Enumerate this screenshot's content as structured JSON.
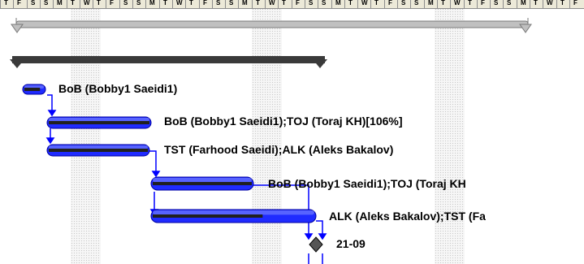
{
  "colors": {
    "task_bar": "#1f2bff",
    "task_bar_light": "#6f7cff",
    "progress": "#202020",
    "summary_bar": "#3a3a3a",
    "project_summary_bar": "#c0c0c0",
    "link_line": "#0000ff",
    "nonworking_shading": "#d8d8d8"
  },
  "timescale": {
    "tick_labels": [
      "T",
      "F",
      "S",
      "S",
      "M",
      "T",
      "W",
      "T",
      "F",
      "S",
      "S",
      "M",
      "T",
      "W",
      "T",
      "F",
      "S",
      "S",
      "M",
      "T",
      "W",
      "T",
      "F",
      "S",
      "S",
      "M",
      "T",
      "W",
      "T",
      "F",
      "S",
      "S",
      "M",
      "T",
      "W",
      "T",
      "F",
      "S",
      "S",
      "M",
      "T",
      "W",
      "T",
      "F"
    ]
  },
  "tasks": [
    {
      "resources": "BoB (Bobby1 Saeidi1)",
      "progress_percent": 80
    },
    {
      "resources": "BoB (Bobby1 Saeidi1);TOJ (Toraj KH)[106%]",
      "progress_percent": 100
    },
    {
      "resources": "TST (Farhood Saeidi);ALK (Aleks Bakalov)",
      "progress_percent": 100
    },
    {
      "resources": "BoB (Bobby1 Saeidi1);TOJ (Toraj KH",
      "progress_percent": 100
    },
    {
      "resources": "ALK (Aleks Bakalov);TST (Fa",
      "progress_percent": 68
    }
  ],
  "milestone": {
    "label": "21-09",
    "icon": "diamond-milestone-icon"
  }
}
